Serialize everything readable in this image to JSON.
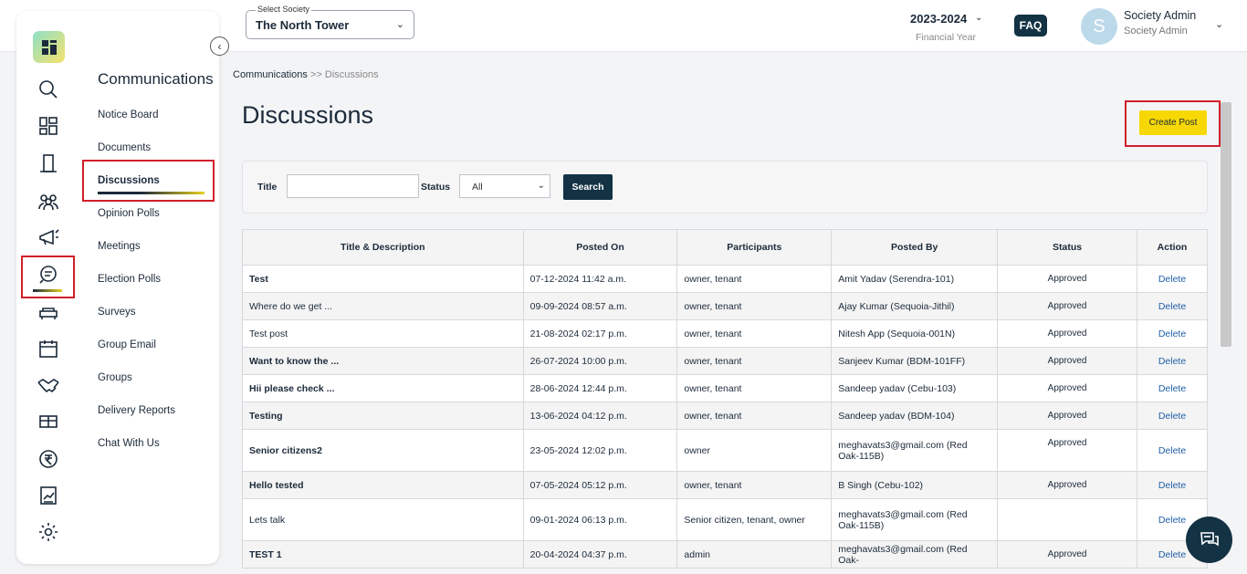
{
  "header": {
    "society_label": "Select Society",
    "society_value": "The North Tower",
    "year": "2023-2024",
    "year_sub": "Financial Year",
    "faq": "FAQ",
    "avatar_initial": "S",
    "user_name": "Society Admin",
    "user_role": "Society Admin"
  },
  "sidebar": {
    "section_title": "Communications",
    "items": [
      {
        "label": "Notice Board"
      },
      {
        "label": "Documents"
      },
      {
        "label": "Discussions",
        "active": true
      },
      {
        "label": "Opinion Polls"
      },
      {
        "label": "Meetings"
      },
      {
        "label": "Election Polls"
      },
      {
        "label": "Surveys"
      },
      {
        "label": "Group Email"
      },
      {
        "label": "Groups"
      },
      {
        "label": "Delivery Reports"
      },
      {
        "label": "Chat With Us"
      }
    ],
    "rail_icons": [
      "search-icon",
      "dashboard-icon",
      "building-icon",
      "people-icon",
      "megaphone-icon",
      "chat-icon",
      "sofa-icon",
      "calendar-icon",
      "handshake-icon",
      "grid-icon",
      "rupee-icon",
      "chart-icon",
      "gear-icon"
    ]
  },
  "breadcrumb": {
    "root": "Communications",
    "sep": ">>",
    "current": "Discussions"
  },
  "page": {
    "title": "Discussions",
    "create_label": "Create Post"
  },
  "filter": {
    "title_label": "Title",
    "title_value": "",
    "status_label": "Status",
    "status_value": "All",
    "search_label": "Search"
  },
  "table": {
    "headers": [
      "Title & Description",
      "Posted On",
      "Participants",
      "Posted By",
      "Status",
      "Action"
    ],
    "rows": [
      {
        "title": "Test",
        "bold": true,
        "posted_on": "07-12-2024 11:42 a.m.",
        "participants": "owner, tenant",
        "posted_by": "Amit Yadav (Serendra-101)",
        "status": "Approved",
        "action": "Delete"
      },
      {
        "title": "Where do we get ...",
        "bold": false,
        "posted_on": "09-09-2024 08:57 a.m.",
        "participants": "owner, tenant",
        "posted_by": "Ajay Kumar (Sequoia-Jithil)",
        "status": "Approved",
        "action": "Delete"
      },
      {
        "title": "Test post",
        "bold": false,
        "posted_on": "21-08-2024 02:17 p.m.",
        "participants": "owner, tenant",
        "posted_by": "Nitesh App (Sequoia-001N)",
        "status": "Approved",
        "action": "Delete"
      },
      {
        "title": "Want to know the ...",
        "bold": true,
        "posted_on": "26-07-2024 10:00 p.m.",
        "participants": "owner, tenant",
        "posted_by": "Sanjeev Kumar (BDM-101FF)",
        "status": "Approved",
        "action": "Delete"
      },
      {
        "title": "Hii please check ...",
        "bold": true,
        "posted_on": "28-06-2024 12:44 p.m.",
        "participants": "owner, tenant",
        "posted_by": "Sandeep yadav (Cebu-103)",
        "status": "Approved",
        "action": "Delete"
      },
      {
        "title": "Testing",
        "bold": true,
        "posted_on": "13-06-2024 04:12 p.m.",
        "participants": "owner, tenant",
        "posted_by": "Sandeep yadav (BDM-104)",
        "status": "Approved",
        "action": "Delete"
      },
      {
        "title": "Senior citizens2",
        "bold": true,
        "posted_on": "23-05-2024 12:02 p.m.",
        "participants": "owner",
        "posted_by": "meghavats3@gmail.com (Red Oak-115B)",
        "status": "Approved",
        "action": "Delete"
      },
      {
        "title": "Hello tested",
        "bold": true,
        "posted_on": "07-05-2024 05:12 p.m.",
        "participants": "owner, tenant",
        "posted_by": "B Singh (Cebu-102)",
        "status": "Approved",
        "action": "Delete"
      },
      {
        "title": "Lets talk",
        "bold": false,
        "posted_on": "09-01-2024 06:13 p.m.",
        "participants": "Senior citizen, tenant, owner",
        "posted_by": "meghavats3@gmail.com (Red Oak-115B)",
        "status": "",
        "action": "Delete"
      },
      {
        "title": "TEST 1",
        "bold": true,
        "posted_on": "20-04-2024 04:37 p.m.",
        "participants": "admin",
        "posted_by": "meghavats3@gmail.com (Red Oak-",
        "status": "Approved",
        "action": "Delete"
      }
    ]
  }
}
